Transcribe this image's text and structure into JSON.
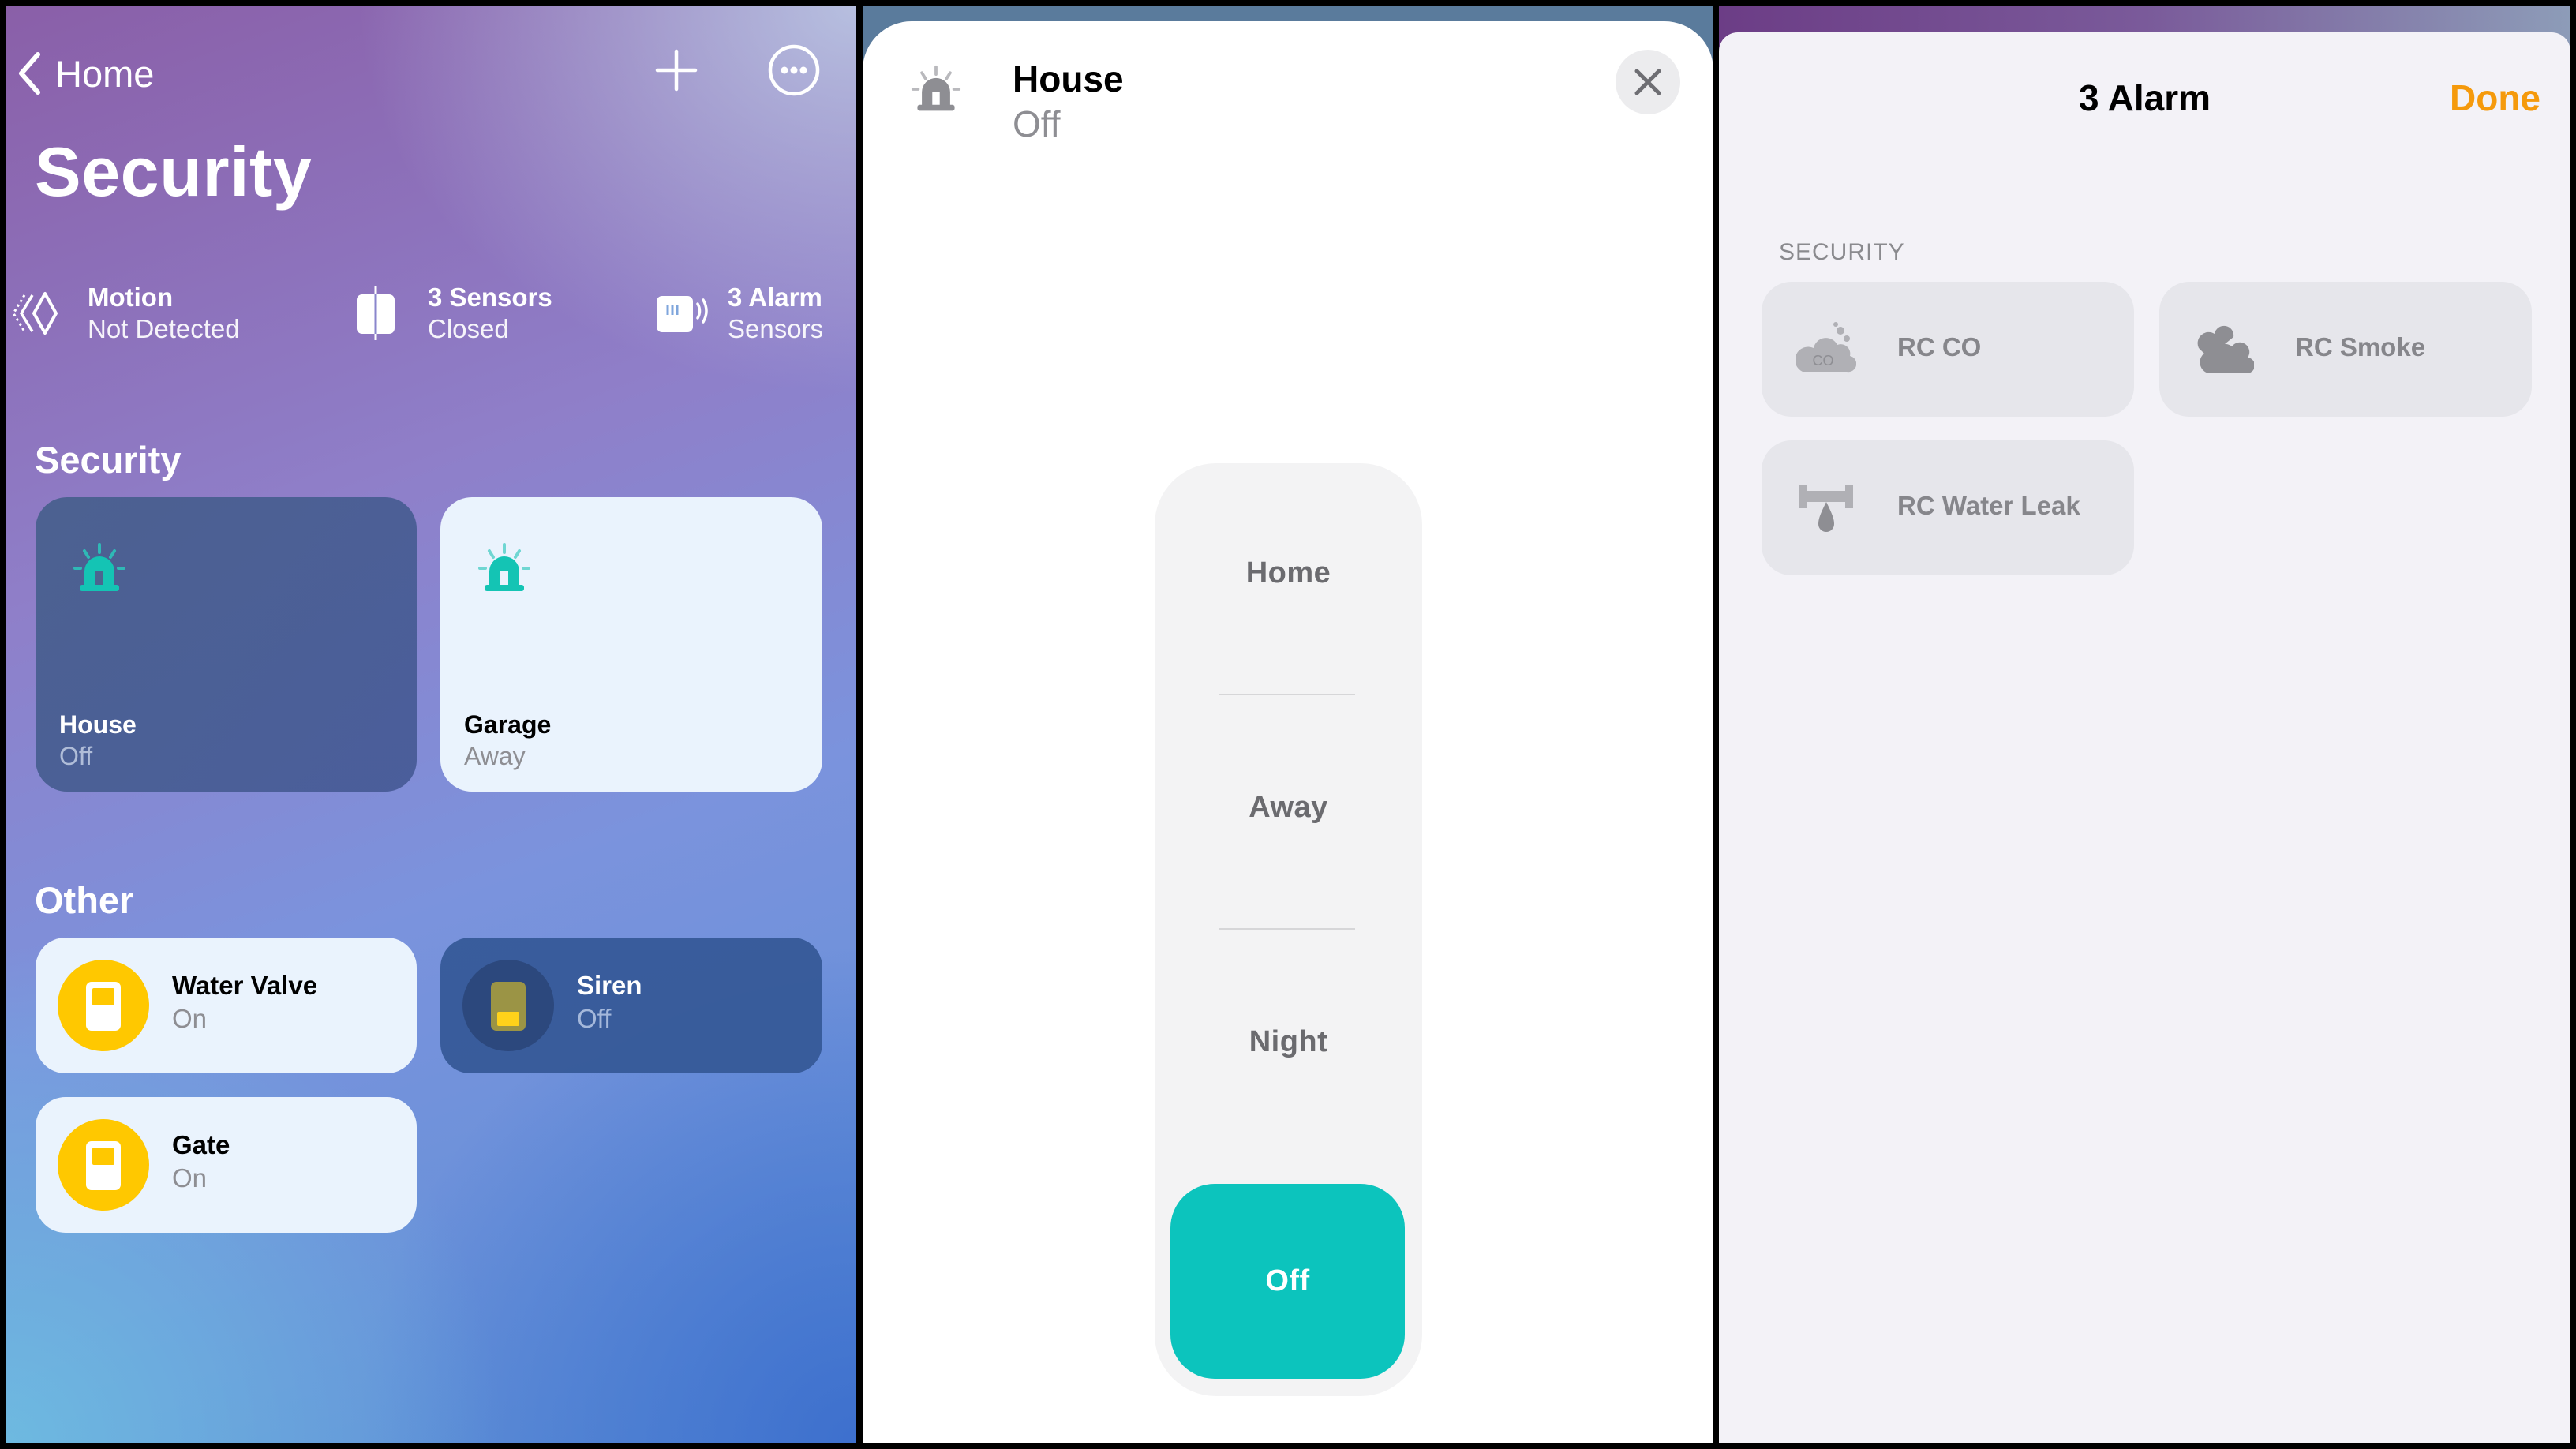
{
  "panel1": {
    "nav": {
      "back_label": "Home",
      "back_icon": "chevron-left-icon",
      "add_icon": "plus-icon",
      "more_icon": "ellipsis-circle-icon"
    },
    "title": "Security",
    "status": [
      {
        "icon": "motion-sensor-icon",
        "title": "Motion",
        "subtitle": "Not Detected"
      },
      {
        "icon": "contact-sensor-icon",
        "title": "3 Sensors",
        "subtitle": "Closed"
      },
      {
        "icon": "alarm-sensor-icon",
        "title": "3 Alarm",
        "subtitle": "Sensors"
      }
    ],
    "security_section": {
      "heading": "Security",
      "tiles": [
        {
          "name": "House",
          "state": "Off",
          "icon": "siren-icon",
          "style": "dark"
        },
        {
          "name": "Garage",
          "state": "Away",
          "icon": "siren-icon",
          "style": "light"
        }
      ]
    },
    "other_section": {
      "heading": "Other",
      "tiles": [
        {
          "name": "Water Valve",
          "state": "On",
          "icon": "switch-icon",
          "style": "light"
        },
        {
          "name": "Siren",
          "state": "Off",
          "icon": "switch-icon",
          "style": "dark"
        },
        {
          "name": "Gate",
          "state": "On",
          "icon": "switch-icon",
          "style": "light"
        }
      ]
    }
  },
  "panel2": {
    "header": {
      "title": "House",
      "subtitle": "Off",
      "icon": "siren-icon",
      "close_icon": "close-icon"
    },
    "modes": [
      "Home",
      "Away",
      "Night",
      "Off"
    ],
    "selected_mode": "Off",
    "accent_color": "#0cc4bd"
  },
  "panel3": {
    "title": "3 Alarm",
    "done_label": "Done",
    "done_color": "#f59a0c",
    "section_caption": "SECURITY",
    "accessories": [
      {
        "name": "RC CO",
        "icon": "co-sensor-icon"
      },
      {
        "name": "RC Smoke",
        "icon": "smoke-sensor-icon"
      },
      {
        "name": "RC Water Leak",
        "icon": "water-leak-sensor-icon"
      }
    ]
  }
}
